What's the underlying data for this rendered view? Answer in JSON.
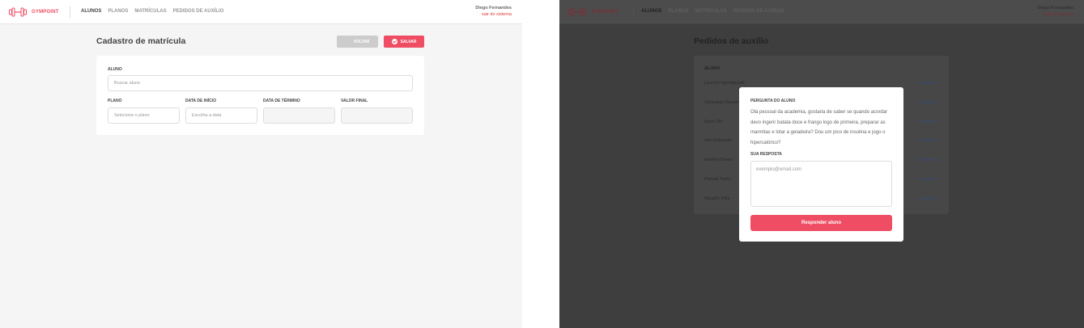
{
  "brand": {
    "name": "GYMPOINT",
    "color": "#ee4d64"
  },
  "nav": {
    "links": [
      "ALUNOS",
      "PLANOS",
      "MATRÍCULAS",
      "PEDIDOS DE AUXÍLIO"
    ],
    "active": "ALUNOS"
  },
  "user": {
    "name": "Diego Fernandes",
    "logout": "sair do sistema"
  },
  "registration": {
    "title": "Cadastro de matrícula",
    "back_label": "VOLTAR",
    "save_label": "SALVAR",
    "student": {
      "label": "ALUNO",
      "placeholder": "Buscar aluno"
    },
    "plan": {
      "label": "PLANO",
      "placeholder": "Selecione o plano"
    },
    "start_date": {
      "label": "DATA DE INÍCIO",
      "placeholder": "Escolha a data"
    },
    "end_date": {
      "label": "DATA DE TÉRMINO",
      "value": ""
    },
    "final_value": {
      "label": "VALOR FINAL",
      "value": ""
    }
  },
  "help_orders": {
    "title": "Pedidos de auxílio",
    "column_header": "ALUNO",
    "rows": [
      {
        "name": "Lennert Nijenbijvank",
        "action": "responder"
      },
      {
        "name": "Sebastian Westergren",
        "action": "responder"
      },
      {
        "name": "Shen Zhi",
        "action": "responder"
      },
      {
        "name": "Alex Edwards",
        "action": "responder"
      },
      {
        "name": "Hashim Bruno",
        "action": "responder"
      },
      {
        "name": "Farhad Tanhi",
        "action": "responder"
      },
      {
        "name": "Nguyễn Diệp",
        "action": "responder"
      }
    ]
  },
  "answer_modal": {
    "question_label": "PERGUNTA DO ALUNO",
    "question": "Olá pessoal da academia, gostaria de saber se quando acordar devo ingerir batata doce e frango logo de primeira, preparar as marmitas e lotar a geladeira? Dou um pico de insulina e jogo o hipercalórico?",
    "answer_label": "SUA RESPOSTA",
    "answer_placeholder": "exemplo@email.com",
    "submit_label": "Responder aluno"
  }
}
